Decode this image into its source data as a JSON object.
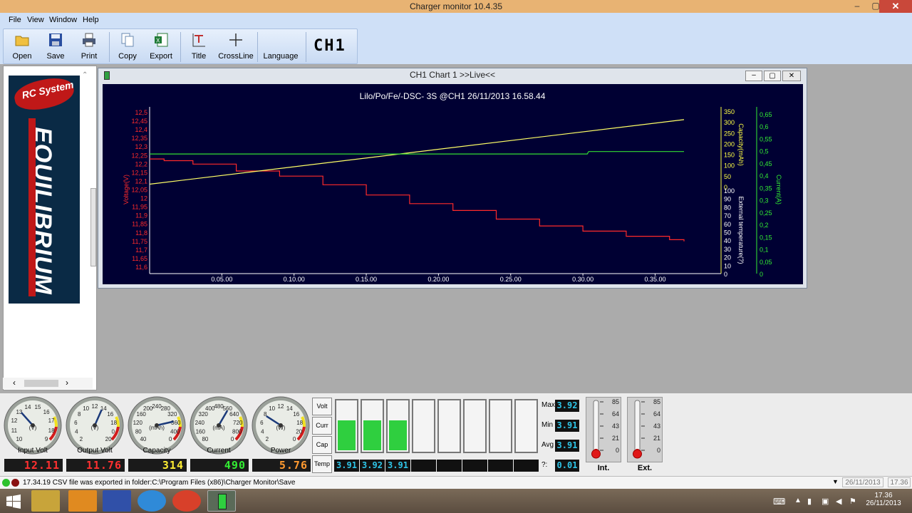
{
  "window": {
    "title": "Charger monitor 10.4.35"
  },
  "menu": [
    "File",
    "View",
    "Window",
    "Help"
  ],
  "toolbar": {
    "open": "Open",
    "save": "Save",
    "print": "Print",
    "copy": "Copy",
    "export": "Export",
    "title": "Title",
    "crossline": "CrossLine",
    "language": "Language",
    "channel": "CH1"
  },
  "sidebar": {
    "brand_small": "RC System",
    "brand_large": "EQUILIBRIUM"
  },
  "chart_window": {
    "title": "CH1 Chart 1 >>Live<<"
  },
  "chart_data": {
    "type": "line",
    "title": "Lilo/Po/Fe/-DSC-  3S  @CH1  26/11/2013  16.58.44",
    "x_ticks": [
      "0.05.00",
      "0.10.00",
      "0.15.00",
      "0.20.00",
      "0.25.00",
      "0.30.00",
      "0.35.00"
    ],
    "x_minutes": [
      0,
      37
    ],
    "axes": {
      "voltage": {
        "label": "Voltage(V)",
        "range": [
          11.6,
          12.5
        ],
        "ticks": [
          "12,5",
          "12,45",
          "12,4",
          "12,35",
          "12,3",
          "12,25",
          "12,2",
          "12,15",
          "12,1",
          "12,05",
          "12",
          "11,95",
          "11,9",
          "11,85",
          "11,8",
          "11,75",
          "11,7",
          "11,65",
          "11,6"
        ],
        "color": "#ff2a2a"
      },
      "capacity": {
        "label": "Capacity(mAh)",
        "range": [
          0,
          350
        ],
        "ticks": [
          "350",
          "300",
          "250",
          "200",
          "150",
          "100",
          "50",
          "0"
        ],
        "color": "#ffff44"
      },
      "temperature": {
        "label": "External temperature(?)",
        "range": [
          0,
          100
        ],
        "ticks": [
          "100",
          "90",
          "80",
          "70",
          "60",
          "50",
          "40",
          "30",
          "20",
          "10",
          "0"
        ],
        "color": "#ffffff"
      },
      "current": {
        "label": "Current(A)",
        "range": [
          0,
          0.65
        ],
        "ticks": [
          "0,65",
          "0,6",
          "0,55",
          "0,5",
          "0,45",
          "0,4",
          "0,35",
          "0,3",
          "0,25",
          "0,2",
          "0,15",
          "0,1",
          "0,05",
          "0"
        ],
        "color": "#33ee33"
      }
    },
    "series": [
      {
        "name": "Voltage(V)",
        "axis": "voltage",
        "color": "#ff2a2a",
        "x": [
          0,
          1,
          3,
          6,
          9,
          12,
          15,
          18,
          21,
          24,
          27,
          30,
          33,
          36,
          37
        ],
        "y": [
          12.23,
          12.22,
          12.2,
          12.16,
          12.13,
          12.08,
          12.02,
          11.97,
          11.93,
          11.88,
          11.84,
          11.81,
          11.78,
          11.76,
          11.75
        ]
      },
      {
        "name": "Capacity(mAh)",
        "axis": "capacity",
        "color": "#ffff44",
        "x": [
          0,
          37
        ],
        "y": [
          15,
          314
        ]
      },
      {
        "name": "Current(A)",
        "axis": "current",
        "color": "#33ee33",
        "x": [
          0,
          30.3,
          30.4,
          37
        ],
        "y": [
          0.49,
          0.49,
          0.5,
          0.5
        ]
      }
    ],
    "grid": false,
    "legend": "none"
  },
  "gauges": [
    {
      "label": "Input Volt",
      "unit": "(V)",
      "ticks": [
        "10",
        "11",
        "12",
        "13",
        "14",
        "15",
        "16",
        "17",
        "18",
        "9"
      ],
      "value": 12.11
    },
    {
      "label": "Output Volt",
      "unit": "(V)",
      "ticks": [
        "2",
        "4",
        "6",
        "8",
        "10",
        "12",
        "14",
        "16",
        "18",
        "0",
        "20"
      ],
      "value": 11.76
    },
    {
      "label": "Capacity",
      "unit": "(mAh)",
      "ticks": [
        "40",
        "80",
        "120",
        "160",
        "200",
        "240",
        "280",
        "320",
        "360",
        "400",
        "0"
      ],
      "value": 314
    },
    {
      "label": "Current",
      "unit": "(mA)",
      "ticks": [
        "80",
        "160",
        "240",
        "320",
        "400",
        "480",
        "560",
        "640",
        "720",
        "800",
        "0"
      ],
      "value": 490
    },
    {
      "label": "Power",
      "unit": "(W)",
      "ticks": [
        "2",
        "4",
        "6",
        "8",
        "10",
        "12",
        "14",
        "16",
        "18",
        "20",
        "0"
      ],
      "value": 5.76
    }
  ],
  "readouts": [
    {
      "value": "12.11",
      "color": "#ff3030"
    },
    {
      "value": "11.76",
      "color": "#ff3030"
    },
    {
      "value": "314",
      "color": "#ffee33"
    },
    {
      "value": "490",
      "color": "#33ee33"
    },
    {
      "value": "5.76",
      "color": "#ff9a30"
    }
  ],
  "side_buttons": [
    "Volt",
    "Curr",
    "Cap",
    "Temp"
  ],
  "cells": {
    "count": 8,
    "fill_levels": [
      0.62,
      0.62,
      0.62,
      0,
      0,
      0,
      0,
      0
    ],
    "values": [
      "3.91",
      "3.92",
      "3.91",
      "",
      "",
      "",
      "",
      ""
    ]
  },
  "stats": {
    "max_label": "Max",
    "max": "3.92",
    "min_label": "Min",
    "min": "3.91",
    "avg_label": "Avg",
    "avg": "3.91",
    "delta_label": "?:",
    "delta": "0.01"
  },
  "thermometers": [
    {
      "label": "Int.",
      "ticks": [
        "85",
        "64",
        "43",
        "21",
        "0"
      ]
    },
    {
      "label": "Ext.",
      "ticks": [
        "85",
        "64",
        "43",
        "21",
        "0"
      ]
    }
  ],
  "status": {
    "message": "17.34.19  CSV file was exported in folder:C:\\Program Files (x86)\\Charger Monitor\\Save",
    "date": "26/11/2013",
    "time": "17.36"
  },
  "taskbar": {
    "time": "17.36",
    "date": "26/11/2013"
  }
}
